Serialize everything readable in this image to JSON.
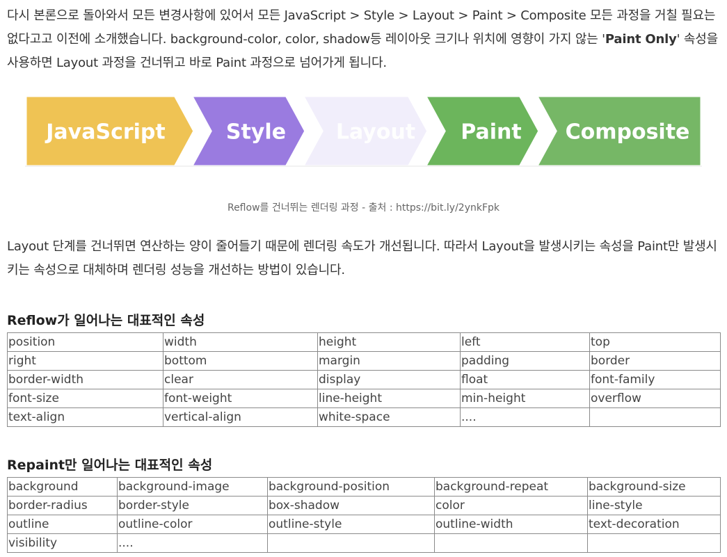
{
  "intro": {
    "text_before": "다시 본론으로 돌아와서 모든 변경사항에 있어서 모든 JavaScript > Style > Layout > Paint > Composite 모든 과정을 거칠 필요는 없다고고 이전에 소개했습니다. background-color, color, shadow등 레이아웃 크기나 위치에 영향이 가지 않는 '",
    "bold": "Paint Only",
    "text_after": "' 속성을 사용하면 Layout 과정을 건너뛰고 바로 Paint 과정으로 넘어가게 됩니다."
  },
  "pipeline": {
    "stages": [
      {
        "label": "JavaScript",
        "color": "#efc354",
        "active": true
      },
      {
        "label": "Style",
        "color": "#9a7be0",
        "active": true
      },
      {
        "label": "Layout",
        "color": "#f1eefb",
        "active": false
      },
      {
        "label": "Paint",
        "color": "#6cb55c",
        "active": true
      },
      {
        "label": "Composite",
        "color": "#76b766",
        "active": true
      }
    ]
  },
  "caption": "Reflow를 건너뛰는 렌더링 과정 - 출처 : https://bit.ly/2ynkFpk",
  "paragraph2": "Layout 단계를 건너뛰면 연산하는 양이 줄어들기 때문에 렌더링 속도가 개선됩니다. 따라서 Layout을 발생시키는 속성을 Paint만 발생시키는 속성으로 대체하며 렌더링 성능을 개선하는 방법이 있습니다.",
  "reflow_section": {
    "heading": "Reflow가 일어나는 대표적인 속성",
    "rows": [
      [
        "position",
        "width",
        "height",
        "left",
        "top"
      ],
      [
        "right",
        "bottom",
        "margin",
        "padding",
        "border"
      ],
      [
        "border-width",
        "clear",
        "display",
        "float",
        "font-family"
      ],
      [
        "font-size",
        "font-weight",
        "line-height",
        "min-height",
        "overflow"
      ],
      [
        "text-align",
        "vertical-align",
        "white-space",
        "....",
        ""
      ]
    ]
  },
  "repaint_section": {
    "heading": "Repaint만 일어나는 대표적인 속성",
    "rows": [
      [
        "background",
        "background-image",
        "background-position",
        "background-repeat",
        "background-size"
      ],
      [
        "border-radius",
        "border-style",
        "box-shadow",
        "color",
        "line-style"
      ],
      [
        "outline",
        "outline-color",
        "outline-style",
        "outline-width",
        "text-decoration"
      ],
      [
        "visibility",
        "....",
        "",
        "",
        ""
      ]
    ]
  }
}
